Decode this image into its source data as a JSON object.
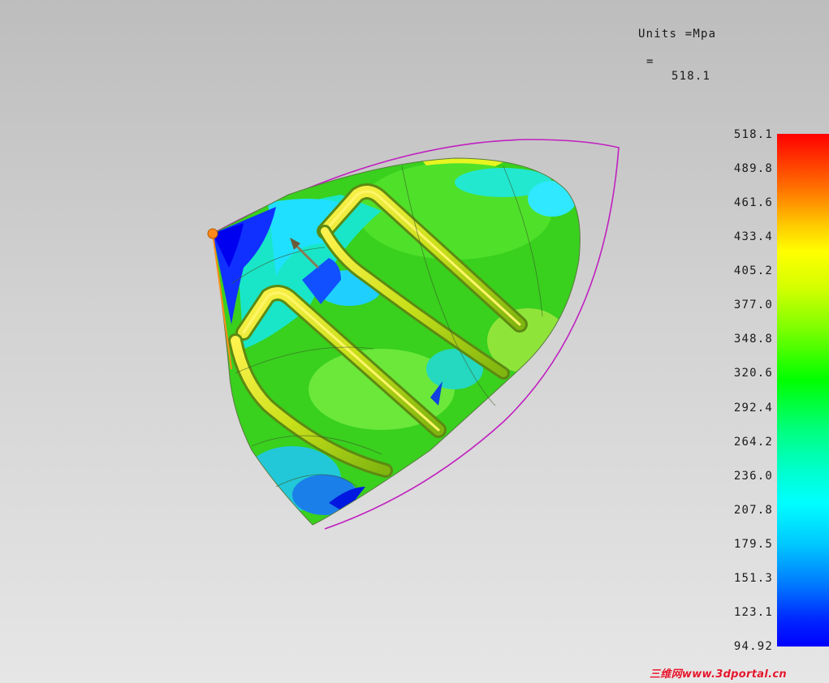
{
  "viewer": {
    "units_label": "Units =Mpa",
    "equals_label": "=",
    "max_value": "518.1"
  },
  "legend": {
    "ticks": [
      "518.1",
      "489.8",
      "461.6",
      "433.4",
      "405.2",
      "377.0",
      "348.8",
      "320.6",
      "292.4",
      "264.2",
      "236.0",
      "207.8",
      "179.5",
      "151.3",
      "123.1",
      "94.92"
    ]
  },
  "colors": {
    "background_top": "#bdbdbd",
    "background_bottom": "#e6e6e6",
    "boundary_outline": "#c020c0",
    "part_green": "#39d01e",
    "stress_high": "#ff0000",
    "stress_low": "#0000ff"
  },
  "watermark": {
    "text": "三维网www.3dportal.cn"
  }
}
